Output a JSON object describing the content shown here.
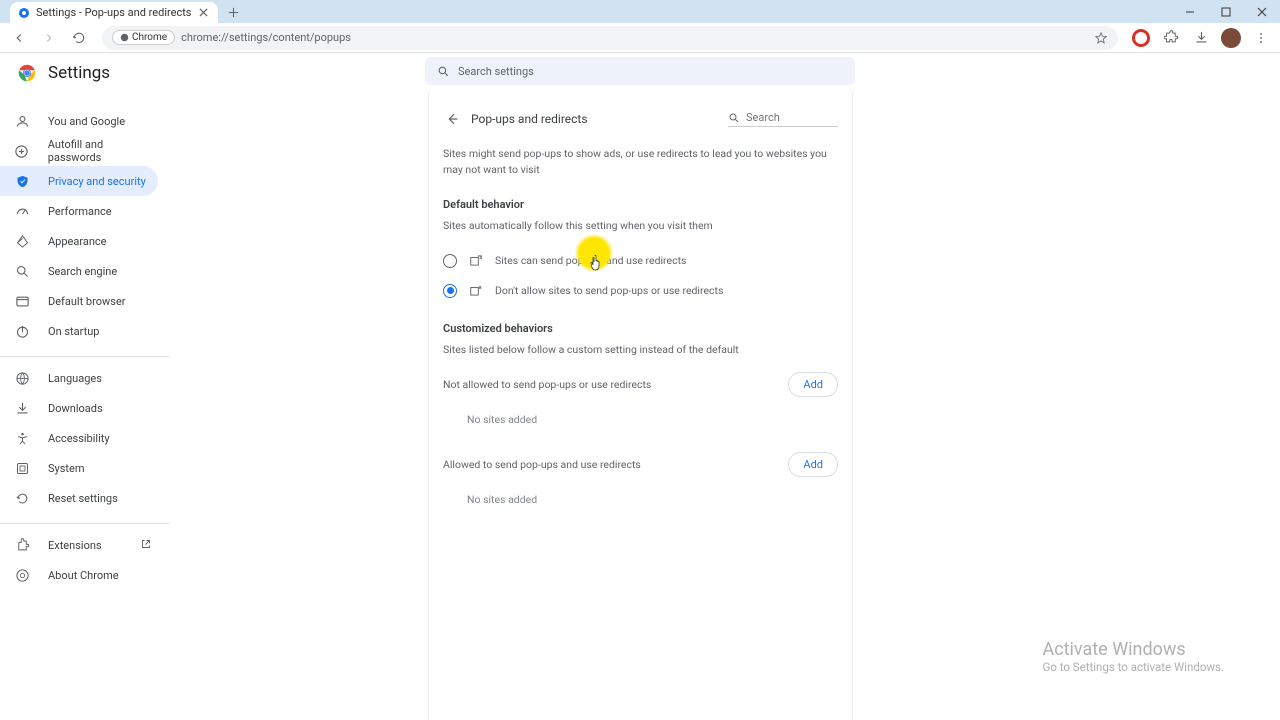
{
  "tab": {
    "title": "Settings - Pop-ups and redirects"
  },
  "address": {
    "chip": "Chrome",
    "url": "chrome://settings/content/popups"
  },
  "header": {
    "title": "Settings",
    "search_placeholder": "Search settings"
  },
  "sidebar": {
    "group1": [
      {
        "label": "You and Google"
      },
      {
        "label": "Autofill and passwords"
      },
      {
        "label": "Privacy and security"
      },
      {
        "label": "Performance"
      },
      {
        "label": "Appearance"
      },
      {
        "label": "Search engine"
      },
      {
        "label": "Default browser"
      },
      {
        "label": "On startup"
      }
    ],
    "group2": [
      {
        "label": "Languages"
      },
      {
        "label": "Downloads"
      },
      {
        "label": "Accessibility"
      },
      {
        "label": "System"
      },
      {
        "label": "Reset settings"
      }
    ],
    "group3": [
      {
        "label": "Extensions"
      },
      {
        "label": "About Chrome"
      }
    ]
  },
  "panel": {
    "title": "Pop-ups and redirects",
    "search_placeholder": "Search",
    "intro": "Sites might send pop-ups to show ads, or use redirects to lead you to websites you may not want to visit",
    "default_h": "Default behavior",
    "default_sub": "Sites automatically follow this setting when you visit them",
    "opt_allow": "Sites can send pop-ups and use redirects",
    "opt_block": "Don't allow sites to send pop-ups or use redirects",
    "custom_h": "Customized behaviors",
    "custom_sub": "Sites listed below follow a custom setting instead of the default",
    "not_allowed_label": "Not allowed to send pop-ups or use redirects",
    "allowed_label": "Allowed to send pop-ups and use redirects",
    "add": "Add",
    "empty": "No sites added"
  },
  "watermark": {
    "line1": "Activate Windows",
    "line2": "Go to Settings to activate Windows."
  }
}
